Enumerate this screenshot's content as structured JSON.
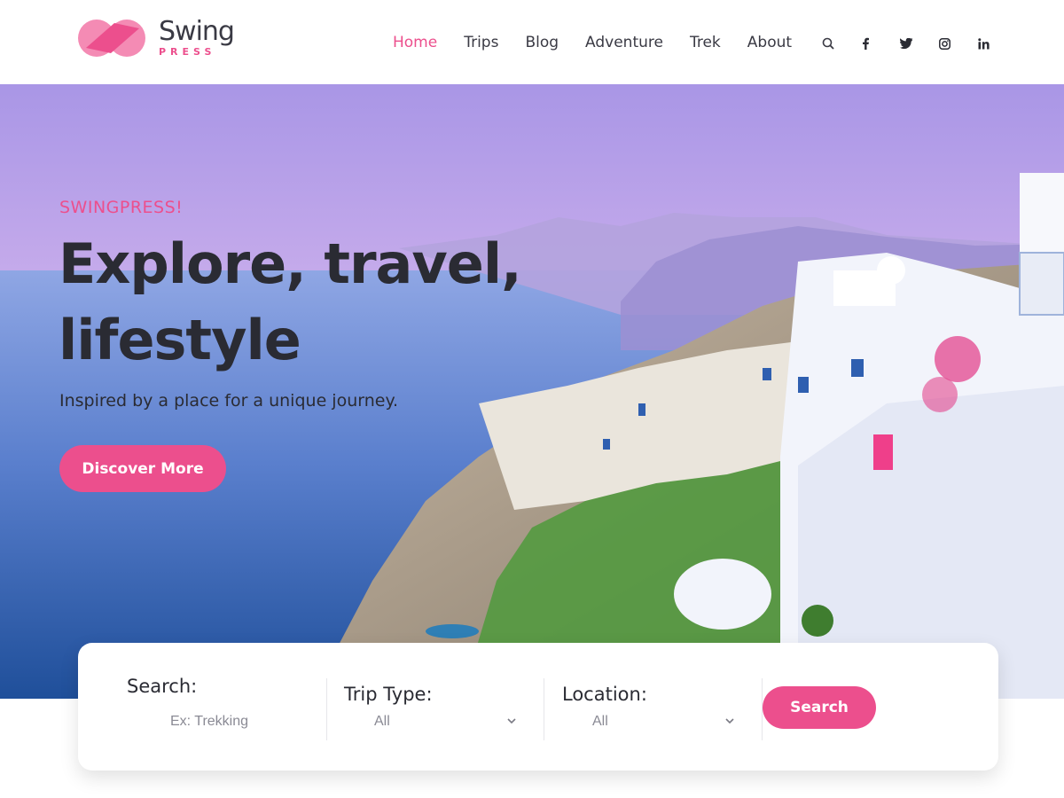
{
  "brand": {
    "name": "Swing",
    "sub": "PRESS",
    "colors": {
      "accent": "#ec4f8d",
      "text": "#2a2b33"
    }
  },
  "nav": {
    "items": [
      {
        "label": "Home",
        "active": true
      },
      {
        "label": "Trips",
        "active": false
      },
      {
        "label": "Blog",
        "active": false
      },
      {
        "label": "Adventure",
        "active": false
      },
      {
        "label": "Trek",
        "active": false
      },
      {
        "label": "About",
        "active": false
      }
    ],
    "icons": [
      "search-icon",
      "facebook-icon",
      "twitter-icon",
      "instagram-icon",
      "linkedin-icon"
    ]
  },
  "hero": {
    "eyebrow": "SWINGPRESS!",
    "headline": "Explore, travel, lifestyle",
    "tagline": "Inspired by a place for a unique journey.",
    "cta": "Discover More"
  },
  "search": {
    "search_label": "Search:",
    "search_placeholder": "Ex: Trekking",
    "trip_type_label": "Trip Type:",
    "trip_type_value": "All",
    "location_label": "Location:",
    "location_value": "All",
    "button": "Search"
  }
}
